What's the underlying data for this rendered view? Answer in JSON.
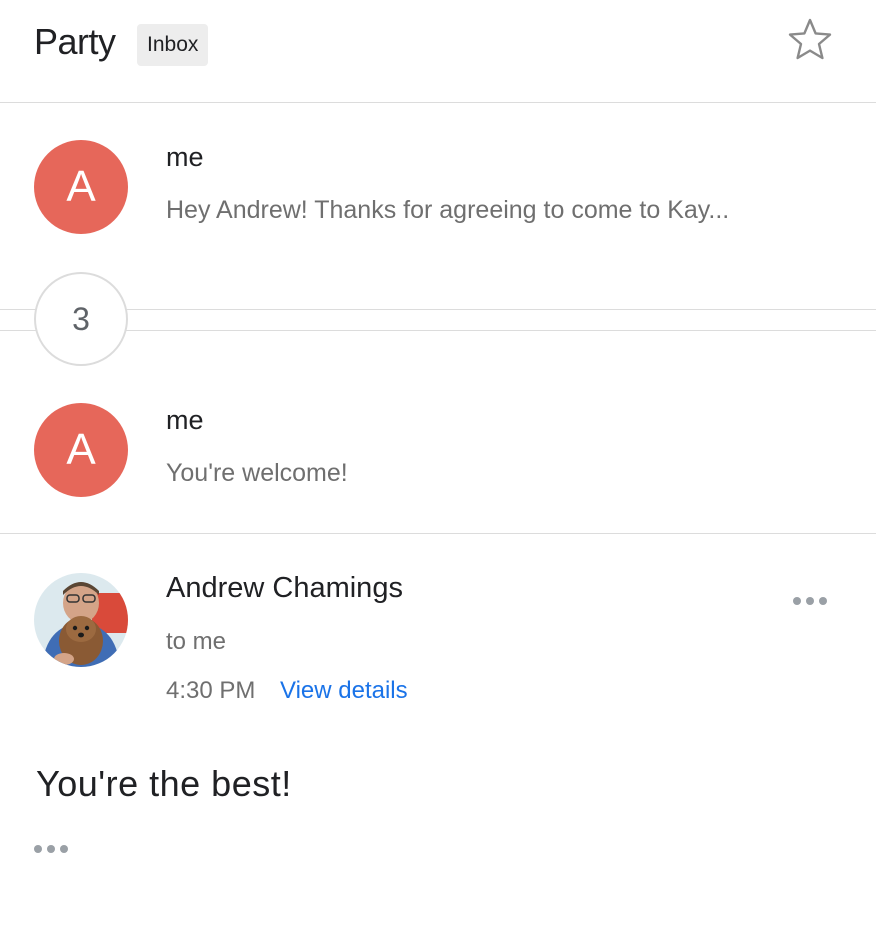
{
  "thread": {
    "subject": "Party",
    "label": "Inbox",
    "star_icon": "star-outline-icon"
  },
  "messages": [
    {
      "avatar_letter": "A",
      "sender": "me",
      "snippet": "Hey Andrew! Thanks for agreeing to come to Kay..."
    },
    {
      "avatar_letter": "A",
      "sender": "me",
      "snippet": "You're welcome!"
    }
  ],
  "collapsed": {
    "count": "3"
  },
  "expanded": {
    "sender": "Andrew Chamings",
    "to_line": "to me",
    "time": "4:30 PM",
    "view_details": "View details",
    "body": "You're the best!",
    "more_icon": "more-horizontal-icon",
    "trimmed_icon": "trimmed-content-icon"
  },
  "colors": {
    "avatar": "#e6675a",
    "link": "#1a73e8",
    "divider": "#dcdcdc"
  }
}
